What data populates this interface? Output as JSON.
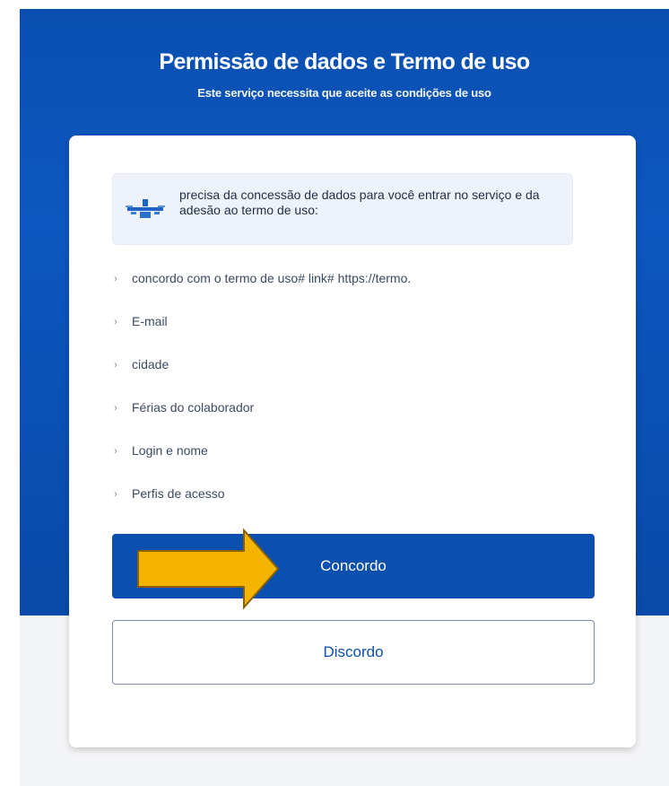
{
  "header": {
    "title": "Permissão de dados e Termo de uso",
    "subtitle": "Este serviço necessita que aceite as condições de uso"
  },
  "notice": {
    "logo_icon": "gov-logo-icon",
    "text": "precisa da concessão de dados para você entrar no serviço e da adesão ao termo de uso:"
  },
  "permissions": [
    {
      "label": "concordo com o termo de uso# link# https://termo."
    },
    {
      "label": "E-mail"
    },
    {
      "label": "cidade"
    },
    {
      "label": "Férias do colaborador"
    },
    {
      "label": "Login e nome"
    },
    {
      "label": "Perfis de acesso"
    }
  ],
  "actions": {
    "agree_label": "Concordo",
    "disagree_label": "Discordo"
  },
  "colors": {
    "primary": "#0b4faf",
    "annotation_arrow": "#f5b400"
  }
}
